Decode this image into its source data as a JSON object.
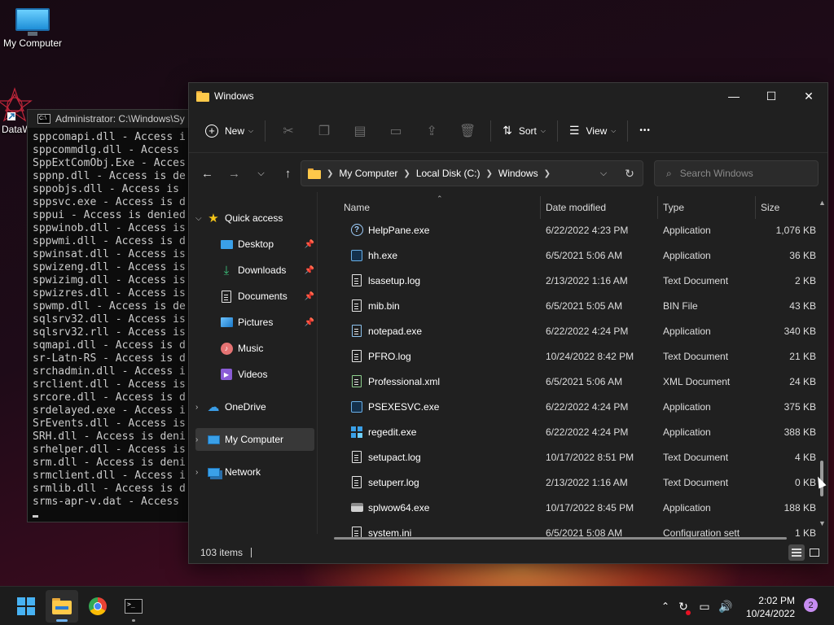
{
  "desktop": {
    "icons": [
      {
        "label": "My Computer",
        "icon": "monitor-icon"
      },
      {
        "label": "DataW",
        "icon": "shortcut-app-icon"
      }
    ]
  },
  "console": {
    "title": "Administrator: C:\\Windows\\Sy",
    "lines": [
      "sppcomapi.dll - Access i",
      "sppcommdlg.dll - Access",
      "SppExtComObj.Exe - Acces",
      "sppnp.dll - Access is de",
      "sppobjs.dll - Access is",
      "sppsvc.exe - Access is d",
      "sppui - Access is denied",
      "sppwinob.dll - Access is",
      "sppwmi.dll - Access is d",
      "spwinsat.dll - Access is",
      "spwizeng.dll - Access is",
      "spwizimg.dll - Access is",
      "spwizres.dll - Access is",
      "spwmp.dll - Access is de",
      "sqlsrv32.dll - Access is",
      "sqlsrv32.rll - Access is",
      "sqmapi.dll - Access is d",
      "sr-Latn-RS - Access is d",
      "srchadmin.dll - Access i",
      "srclient.dll - Access is",
      "srcore.dll - Access is d",
      "srdelayed.exe - Access i",
      "SrEvents.dll - Access is",
      "SRH.dll - Access is deni",
      "srhelper.dll - Access is",
      "srm.dll - Access is deni",
      "srmclient.dll - Access i",
      "srmlib.dll - Access is d",
      "srms-apr-v.dat - Access"
    ]
  },
  "explorer": {
    "title": "Windows",
    "controls": {
      "minimize": "—",
      "maximize": "☐",
      "close": "✕"
    },
    "toolbar": {
      "new_label": "New",
      "sort_label": "Sort",
      "view_label": "View",
      "more_label": "•••"
    },
    "address": {
      "crumbs": [
        "My Computer",
        "Local Disk (C:)",
        "Windows"
      ]
    },
    "search": {
      "placeholder": "Search Windows"
    },
    "nav": {
      "quick_access": "Quick access",
      "items": [
        {
          "label": "Desktop",
          "icon": "desktop-folder-icon",
          "pinned": true
        },
        {
          "label": "Downloads",
          "icon": "downloads-icon",
          "pinned": true
        },
        {
          "label": "Documents",
          "icon": "documents-icon",
          "pinned": true
        },
        {
          "label": "Pictures",
          "icon": "pictures-icon",
          "pinned": true
        },
        {
          "label": "Music",
          "icon": "music-icon",
          "pinned": false
        },
        {
          "label": "Videos",
          "icon": "videos-icon",
          "pinned": false
        }
      ],
      "onedrive": "OneDrive",
      "my_computer": "My Computer",
      "network": "Network"
    },
    "columns": {
      "name": "Name",
      "date": "Date modified",
      "type": "Type",
      "size": "Size"
    },
    "files": [
      {
        "name": "HelpPane.exe",
        "date": "6/22/2022 4:23 PM",
        "type": "Application",
        "size": "1,076 KB",
        "icon": "help-icon"
      },
      {
        "name": "hh.exe",
        "date": "6/5/2021 5:06 AM",
        "type": "Application",
        "size": "36 KB",
        "icon": "app-icon"
      },
      {
        "name": "lsasetup.log",
        "date": "2/13/2022 1:16 AM",
        "type": "Text Document",
        "size": "2 KB",
        "icon": "text-file-icon"
      },
      {
        "name": "mib.bin",
        "date": "6/5/2021 5:05 AM",
        "type": "BIN File",
        "size": "43 KB",
        "icon": "file-icon"
      },
      {
        "name": "notepad.exe",
        "date": "6/22/2022 4:24 PM",
        "type": "Application",
        "size": "340 KB",
        "icon": "notepad-icon"
      },
      {
        "name": "PFRO.log",
        "date": "10/24/2022 8:42 PM",
        "type": "Text Document",
        "size": "21 KB",
        "icon": "text-file-icon"
      },
      {
        "name": "Professional.xml",
        "date": "6/5/2021 5:06 AM",
        "type": "XML Document",
        "size": "24 KB",
        "icon": "xml-file-icon"
      },
      {
        "name": "PSEXESVC.exe",
        "date": "6/22/2022 4:24 PM",
        "type": "Application",
        "size": "375 KB",
        "icon": "app-icon"
      },
      {
        "name": "regedit.exe",
        "date": "6/22/2022 4:24 PM",
        "type": "Application",
        "size": "388 KB",
        "icon": "regedit-icon"
      },
      {
        "name": "setupact.log",
        "date": "10/17/2022 8:51 PM",
        "type": "Text Document",
        "size": "4 KB",
        "icon": "text-file-icon"
      },
      {
        "name": "setuperr.log",
        "date": "2/13/2022 1:16 AM",
        "type": "Text Document",
        "size": "0 KB",
        "icon": "text-file-icon"
      },
      {
        "name": "splwow64.exe",
        "date": "10/17/2022 8:45 PM",
        "type": "Application",
        "size": "188 KB",
        "icon": "printer-icon"
      },
      {
        "name": "system.ini",
        "date": "6/5/2021 5:08 AM",
        "type": "Configuration sett",
        "size": "1 KB",
        "icon": "ini-file-icon"
      }
    ],
    "status": {
      "items_count": "103 items"
    }
  },
  "taskbar": {
    "apps": [
      "start-icon",
      "file-explorer-icon",
      "chrome-icon",
      "terminal-icon"
    ],
    "clock": {
      "time": "2:02 PM",
      "date": "10/24/2022"
    },
    "notifications": "2"
  }
}
